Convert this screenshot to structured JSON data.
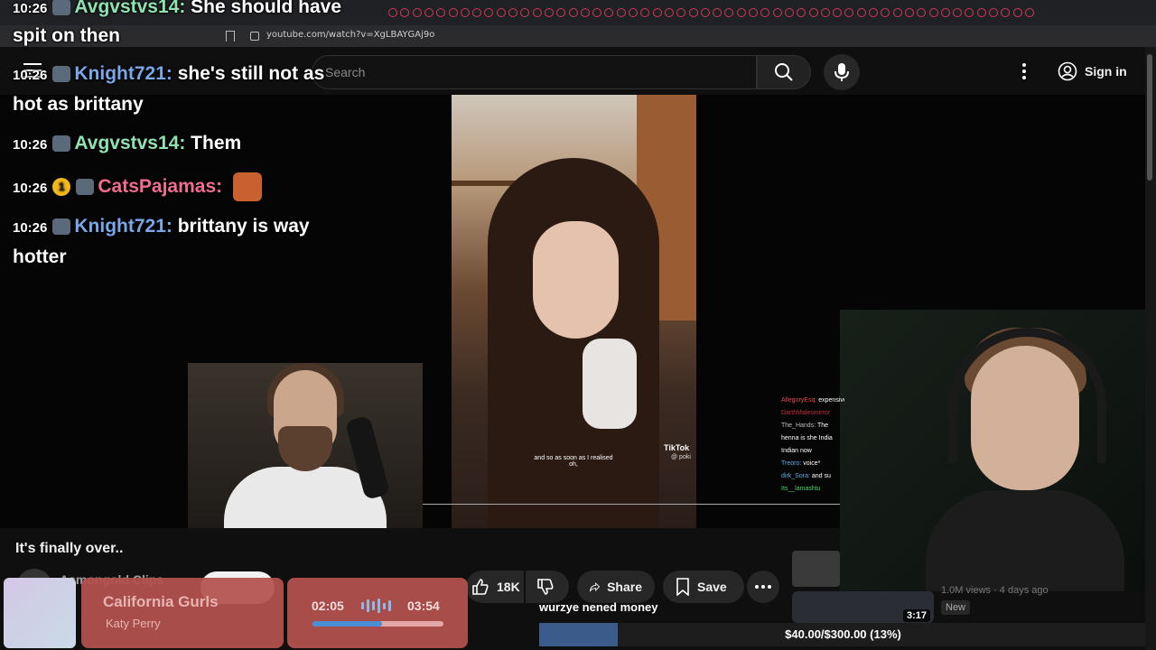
{
  "browser": {
    "url": "youtube.com/watch?v=XgLBAYGAj9o",
    "tab_count": 54
  },
  "header": {
    "search_placeholder": "Search",
    "sign_in_label": "Sign in"
  },
  "chat_overlay": [
    {
      "time": "10:26",
      "user": "Avgvstvs14",
      "color": "#8fe3b3",
      "text": "She should have"
    },
    {
      "time": "",
      "user": "",
      "color": "#ffffff",
      "text": "spit on then"
    },
    {
      "time": "10:26",
      "user": "Knight721",
      "color": "#7aa7e8",
      "text": "she's still not as"
    },
    {
      "time": "",
      "user": "",
      "color": "#ffffff",
      "text": "hot as brittany"
    },
    {
      "time": "10:26",
      "user": "Avgvstvs14",
      "color": "#8fe3b3",
      "text": "Them"
    },
    {
      "time": "10:26",
      "user": "CatsPajamas",
      "color": "#ef6d8e",
      "text": "",
      "coin": "1"
    },
    {
      "time": "10:26",
      "user": "Knight721",
      "color": "#7aa7e8",
      "text": "brittany is way"
    },
    {
      "time": "",
      "user": "",
      "color": "#ffffff",
      "text": "hotter"
    }
  ],
  "tiktok": {
    "caption_line1": "and so as soon as I realised",
    "caption_line2": "oh,",
    "logo": "TikTok",
    "handle": "@ poki"
  },
  "mini_chat": [
    {
      "user": "AllegoryEsq",
      "text": "expensive bad coo",
      "color": "#e14b4b"
    },
    {
      "user": "DarthMalesmirror",
      "text": "",
      "color": "#c2303a"
    },
    {
      "user": "The_Hands",
      "text": "The",
      "color": "#bdbdbd"
    },
    {
      "user": "",
      "text": "henna is she India",
      "color": "#ffffff"
    },
    {
      "user": "",
      "text": "Indian now",
      "color": "#ffffff"
    },
    {
      "user": "Treoro",
      "text": "voice*",
      "color": "#5fb0e6"
    },
    {
      "user": "dirk_Sora",
      "text": "and su",
      "color": "#5fb0e6"
    },
    {
      "user": "Its__lamashtu",
      "text": "",
      "color": "#56d06a"
    }
  ],
  "video": {
    "title": "It's finally over..",
    "channel": "Asmongold Clips",
    "like_count": "18K",
    "share_label": "Share",
    "save_label": "Save"
  },
  "music": {
    "song": "California Gurls",
    "artist": "Katy Perry",
    "current_time": "02:05",
    "total_time": "03:54",
    "progress": 0.53
  },
  "donation": {
    "name": "wurzye nened money",
    "goal_text": "$40.00/$300.00 (13%)",
    "progress": 0.13
  },
  "recommendation": {
    "duration": "3:17",
    "meta": "1.0M views · 4 days ago",
    "badge": "New"
  }
}
